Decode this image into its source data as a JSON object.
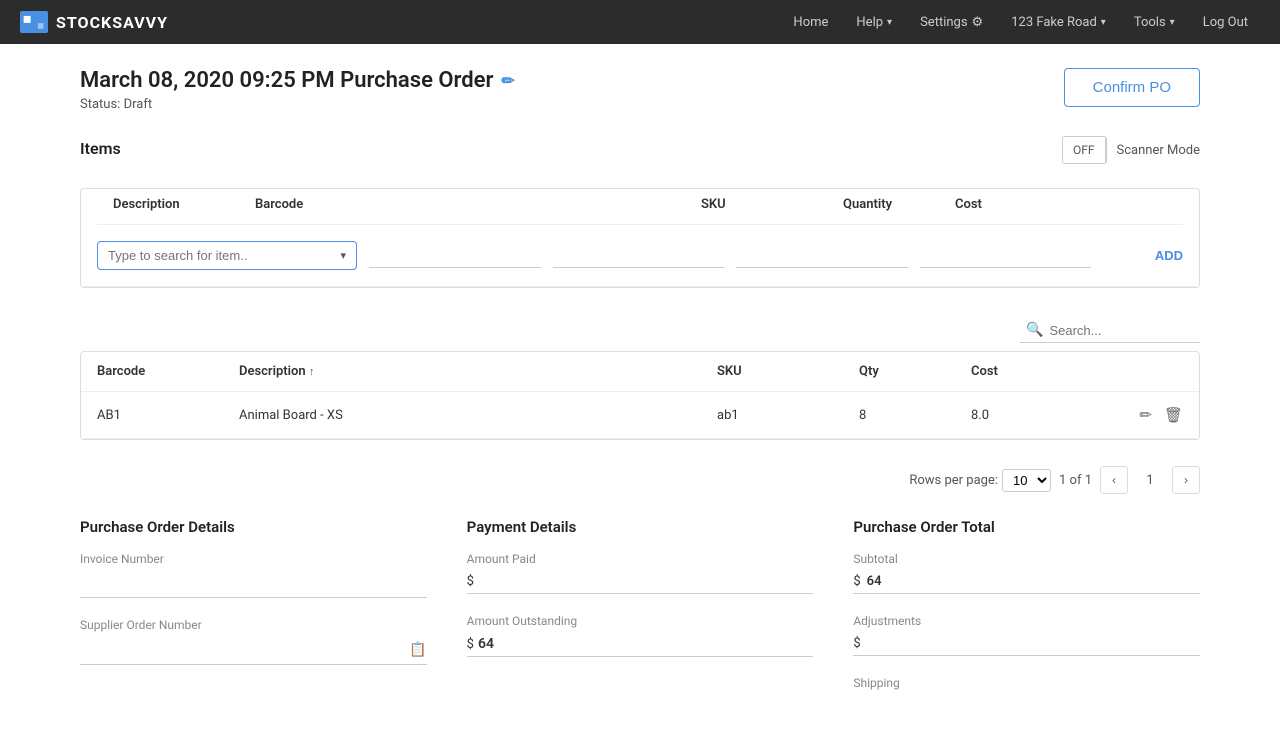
{
  "brand": {
    "name": "STOCKSAVVY"
  },
  "nav": {
    "links": [
      {
        "label": "Home",
        "hasDropdown": false
      },
      {
        "label": "Help",
        "hasDropdown": true
      },
      {
        "label": "Settings",
        "hasDropdown": false,
        "hasGear": true
      },
      {
        "label": "123 Fake Road",
        "hasDropdown": true
      },
      {
        "label": "Tools",
        "hasDropdown": true
      },
      {
        "label": "Log Out",
        "hasDropdown": false
      }
    ]
  },
  "page": {
    "title": "March 08, 2020 09:25 PM Purchase Order",
    "status_label": "Status:",
    "status_value": "Draft",
    "confirm_btn": "Confirm PO"
  },
  "items_section": {
    "label": "Items",
    "scanner_off": "OFF",
    "scanner_mode": "Scanner Mode",
    "search_placeholder": "Type to search for item..",
    "add_btn": "ADD",
    "table_cols": [
      "Description",
      "Barcode",
      "SKU",
      "Quantity",
      "Cost"
    ]
  },
  "data_table": {
    "cols": [
      "Barcode",
      "Description",
      "SKU",
      "Qty",
      "Cost"
    ],
    "rows": [
      {
        "barcode": "AB1",
        "description": "Animal Board - XS",
        "sku": "ab1",
        "qty": "8",
        "cost": "8.0"
      }
    ],
    "search_placeholder": "Search..."
  },
  "pagination": {
    "rows_per_page_label": "Rows per page:",
    "rows_per_page_value": "10",
    "page_info": "1 of 1",
    "current_page": "1"
  },
  "purchase_order_details": {
    "title": "Purchase Order Details",
    "invoice_number_label": "Invoice Number",
    "invoice_number_value": "",
    "supplier_order_label": "Supplier Order Number",
    "supplier_order_value": ""
  },
  "payment_details": {
    "title": "Payment Details",
    "amount_paid_label": "Amount Paid",
    "amount_paid_prefix": "$",
    "amount_paid_value": "",
    "amount_outstanding_label": "Amount Outstanding",
    "amount_outstanding_prefix": "$",
    "amount_outstanding_value": "64"
  },
  "po_total": {
    "title": "Purchase Order Total",
    "subtotal_label": "Subtotal",
    "subtotal_prefix": "$",
    "subtotal_value": "64",
    "adjustments_label": "Adjustments",
    "adjustments_prefix": "$",
    "adjustments_value": "",
    "shipping_label": "Shipping"
  }
}
